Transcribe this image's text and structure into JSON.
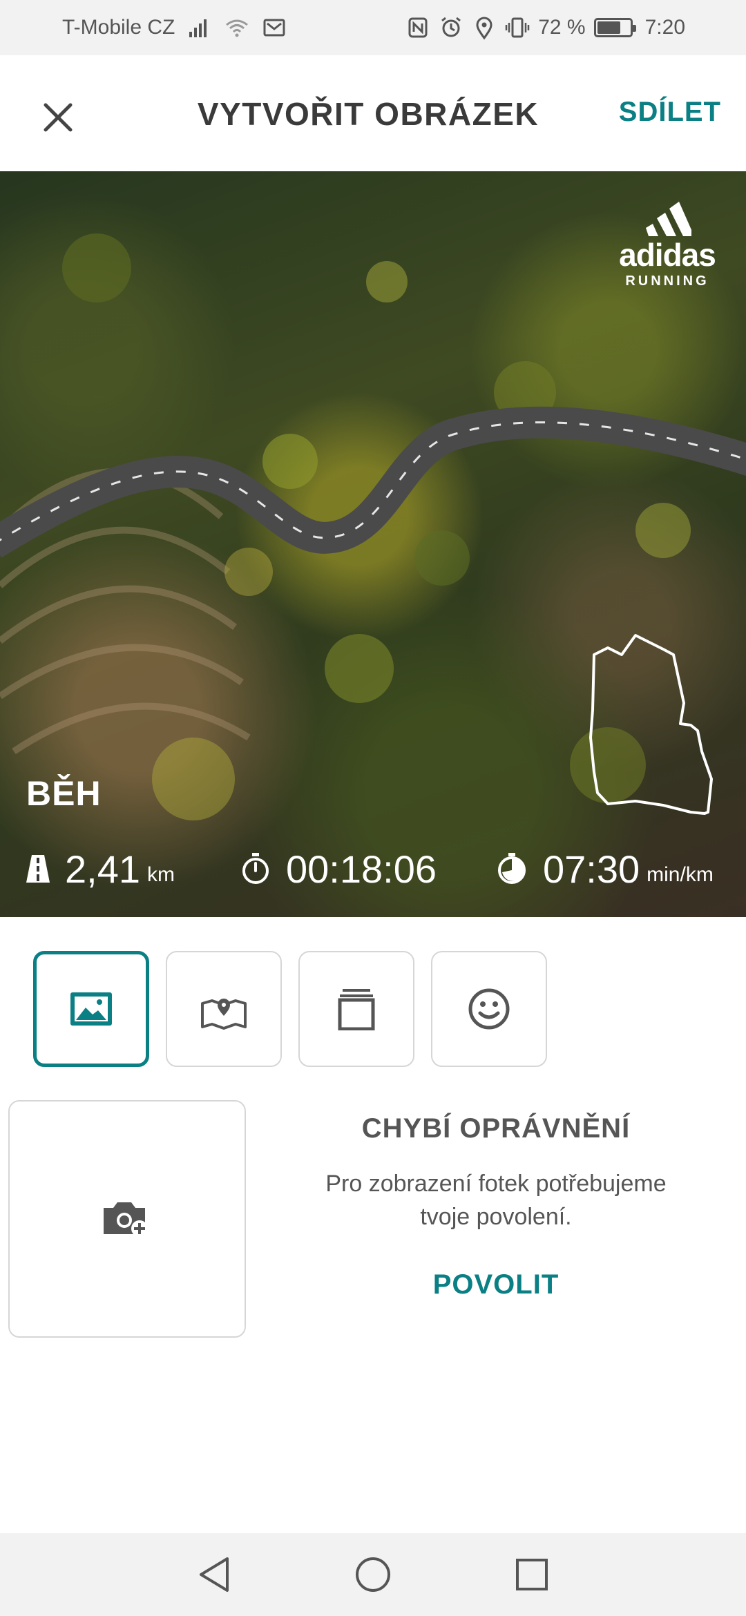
{
  "status_bar": {
    "carrier": "T-Mobile CZ",
    "battery": "72 %",
    "battery_level": 0.72,
    "time": "7:20",
    "icons": [
      "signal-icon",
      "wifi-icon",
      "message-icon",
      "nfc-icon",
      "alarm-icon",
      "location-icon",
      "vibrate-icon",
      "battery-icon"
    ]
  },
  "header": {
    "title": "VYTVOŘIT OBRÁZEK",
    "share_label": "SDÍLET",
    "close_icon": "close-icon"
  },
  "preview": {
    "brand_name": "adidas",
    "brand_sub": "RUNNING",
    "activity": "BĚH",
    "stats": {
      "distance_value": "2,41",
      "distance_unit": "km",
      "duration_value": "00:18:06",
      "pace_value": "07:30",
      "pace_unit": "min/km"
    },
    "icons": [
      "road-icon",
      "stopwatch-icon",
      "pace-icon",
      "route-map-outline"
    ]
  },
  "tabs": [
    {
      "name": "photo",
      "icon": "image-icon",
      "active": true
    },
    {
      "name": "map",
      "icon": "map-pin-icon",
      "active": false
    },
    {
      "name": "layout",
      "icon": "layers-icon",
      "active": false
    },
    {
      "name": "sticker",
      "icon": "smiley-icon",
      "active": false
    }
  ],
  "gallery": {
    "camera_icon": "camera-add-icon",
    "permission_title": "CHYBÍ OPRÁVNĚNÍ",
    "permission_text_line1": "Pro zobrazení fotek potřebujeme",
    "permission_text_line2": "tvoje povolení.",
    "allow_label": "POVOLIT"
  },
  "nav_bar": {
    "icons": [
      "back-icon",
      "home-icon",
      "recents-icon"
    ]
  },
  "colors": {
    "accent": "#0a7f84",
    "text_dark": "#3a3a3a",
    "border": "#d6d6d6"
  }
}
